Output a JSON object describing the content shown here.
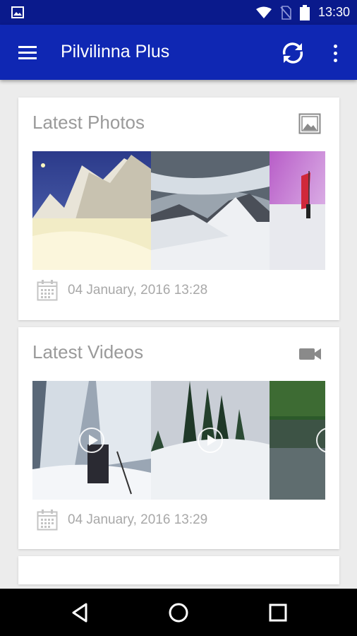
{
  "status_bar": {
    "time": "13:30",
    "icons": [
      "image-icon",
      "wifi-icon",
      "no-sim-icon",
      "battery-icon"
    ]
  },
  "app_bar": {
    "title": "Pilvilinna Plus",
    "icons": [
      "menu-icon",
      "refresh-icon",
      "more-vert-icon"
    ]
  },
  "photos_card": {
    "title": "Latest Photos",
    "icon": "photo-icon",
    "date": "04 January, 2016 13:28"
  },
  "videos_card": {
    "title": "Latest Videos",
    "icon": "videocam-icon",
    "date": "04 January, 2016 13:29"
  },
  "nav_bar": {
    "icons": [
      "back-icon",
      "home-icon",
      "recents-icon"
    ]
  },
  "colors": {
    "status_bar": "#0a1a8c",
    "app_bar": "#0f27b3",
    "background": "#ececec",
    "card": "#ffffff",
    "muted_text": "#9a9a9a"
  }
}
